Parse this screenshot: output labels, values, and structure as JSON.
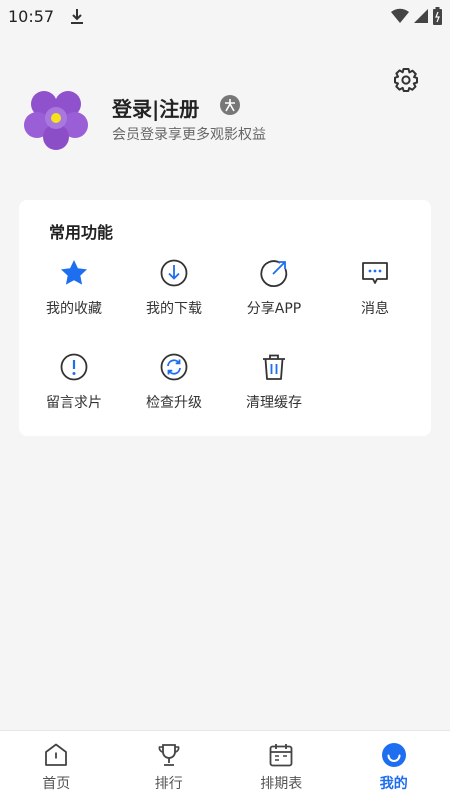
{
  "status_bar": {
    "time": "10:57"
  },
  "profile": {
    "login_label": "登录|注册",
    "subtitle": "会员登录享更多观影权益"
  },
  "functions": {
    "title": "常用功能",
    "items": [
      {
        "label": "我的收藏",
        "icon": "star-icon"
      },
      {
        "label": "我的下载",
        "icon": "download-icon"
      },
      {
        "label": "分享APP",
        "icon": "share-icon"
      },
      {
        "label": "消息",
        "icon": "message-icon"
      },
      {
        "label": "留言求片",
        "icon": "alert-icon"
      },
      {
        "label": "检查升级",
        "icon": "refresh-icon"
      },
      {
        "label": "清理缓存",
        "icon": "trash-icon"
      }
    ]
  },
  "bottom_nav": {
    "items": [
      {
        "label": "首页",
        "icon": "home-icon",
        "active": false
      },
      {
        "label": "排行",
        "icon": "trophy-icon",
        "active": false
      },
      {
        "label": "排期表",
        "icon": "calendar-icon",
        "active": false
      },
      {
        "label": "我的",
        "icon": "smile-icon",
        "active": true
      }
    ]
  },
  "colors": {
    "accent": "#1e6ef0",
    "background": "#f5f5f5"
  }
}
